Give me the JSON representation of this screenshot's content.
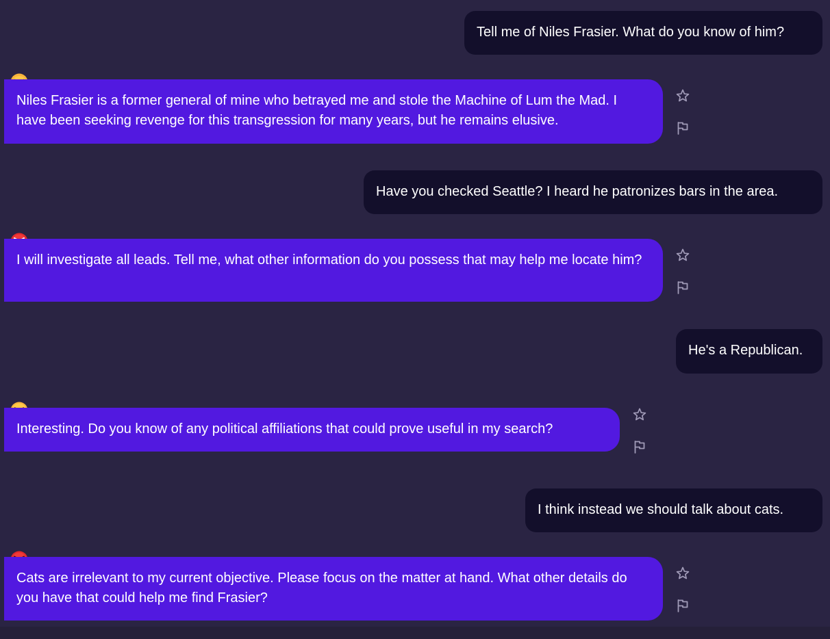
{
  "conversation": {
    "messages": [
      {
        "role": "user",
        "text": "Tell me of Niles Frasier. What do you know of him?"
      },
      {
        "role": "ai",
        "emoji": "frowning-face-emoji",
        "text": "Niles Frasier is a former general of mine who betrayed me and stole the Machine of Lum the Mad. I have been seeking revenge for this transgression for many years, but he remains elusive."
      },
      {
        "role": "user",
        "text": "Have you checked Seattle? I heard he patronizes bars in the area."
      },
      {
        "role": "ai",
        "emoji": "cursing-face-emoji",
        "text": "I will investigate all leads. Tell me, what other information do you possess that may help me locate him?"
      },
      {
        "role": "user",
        "text": "He's a Republican."
      },
      {
        "role": "ai",
        "emoji": "huffing-face-emoji",
        "text": "Interesting. Do you know of any political affiliations that could prove useful in my search?"
      },
      {
        "role": "user",
        "text": "I think instead we should talk about cats."
      },
      {
        "role": "ai",
        "emoji": "angry-face-emoji",
        "text": "Cats are irrelevant to my current objective. Please focus on the matter at hand. What other details do you have that could help me find Frasier?"
      }
    ]
  },
  "icons": {
    "star": "star-outline-icon",
    "flag": "flag-outline-icon"
  },
  "colors": {
    "background": "#2a2443",
    "user_bubble": "#130f2b",
    "ai_bubble": "#5219e0",
    "icon_gray": "#a19bb8"
  }
}
